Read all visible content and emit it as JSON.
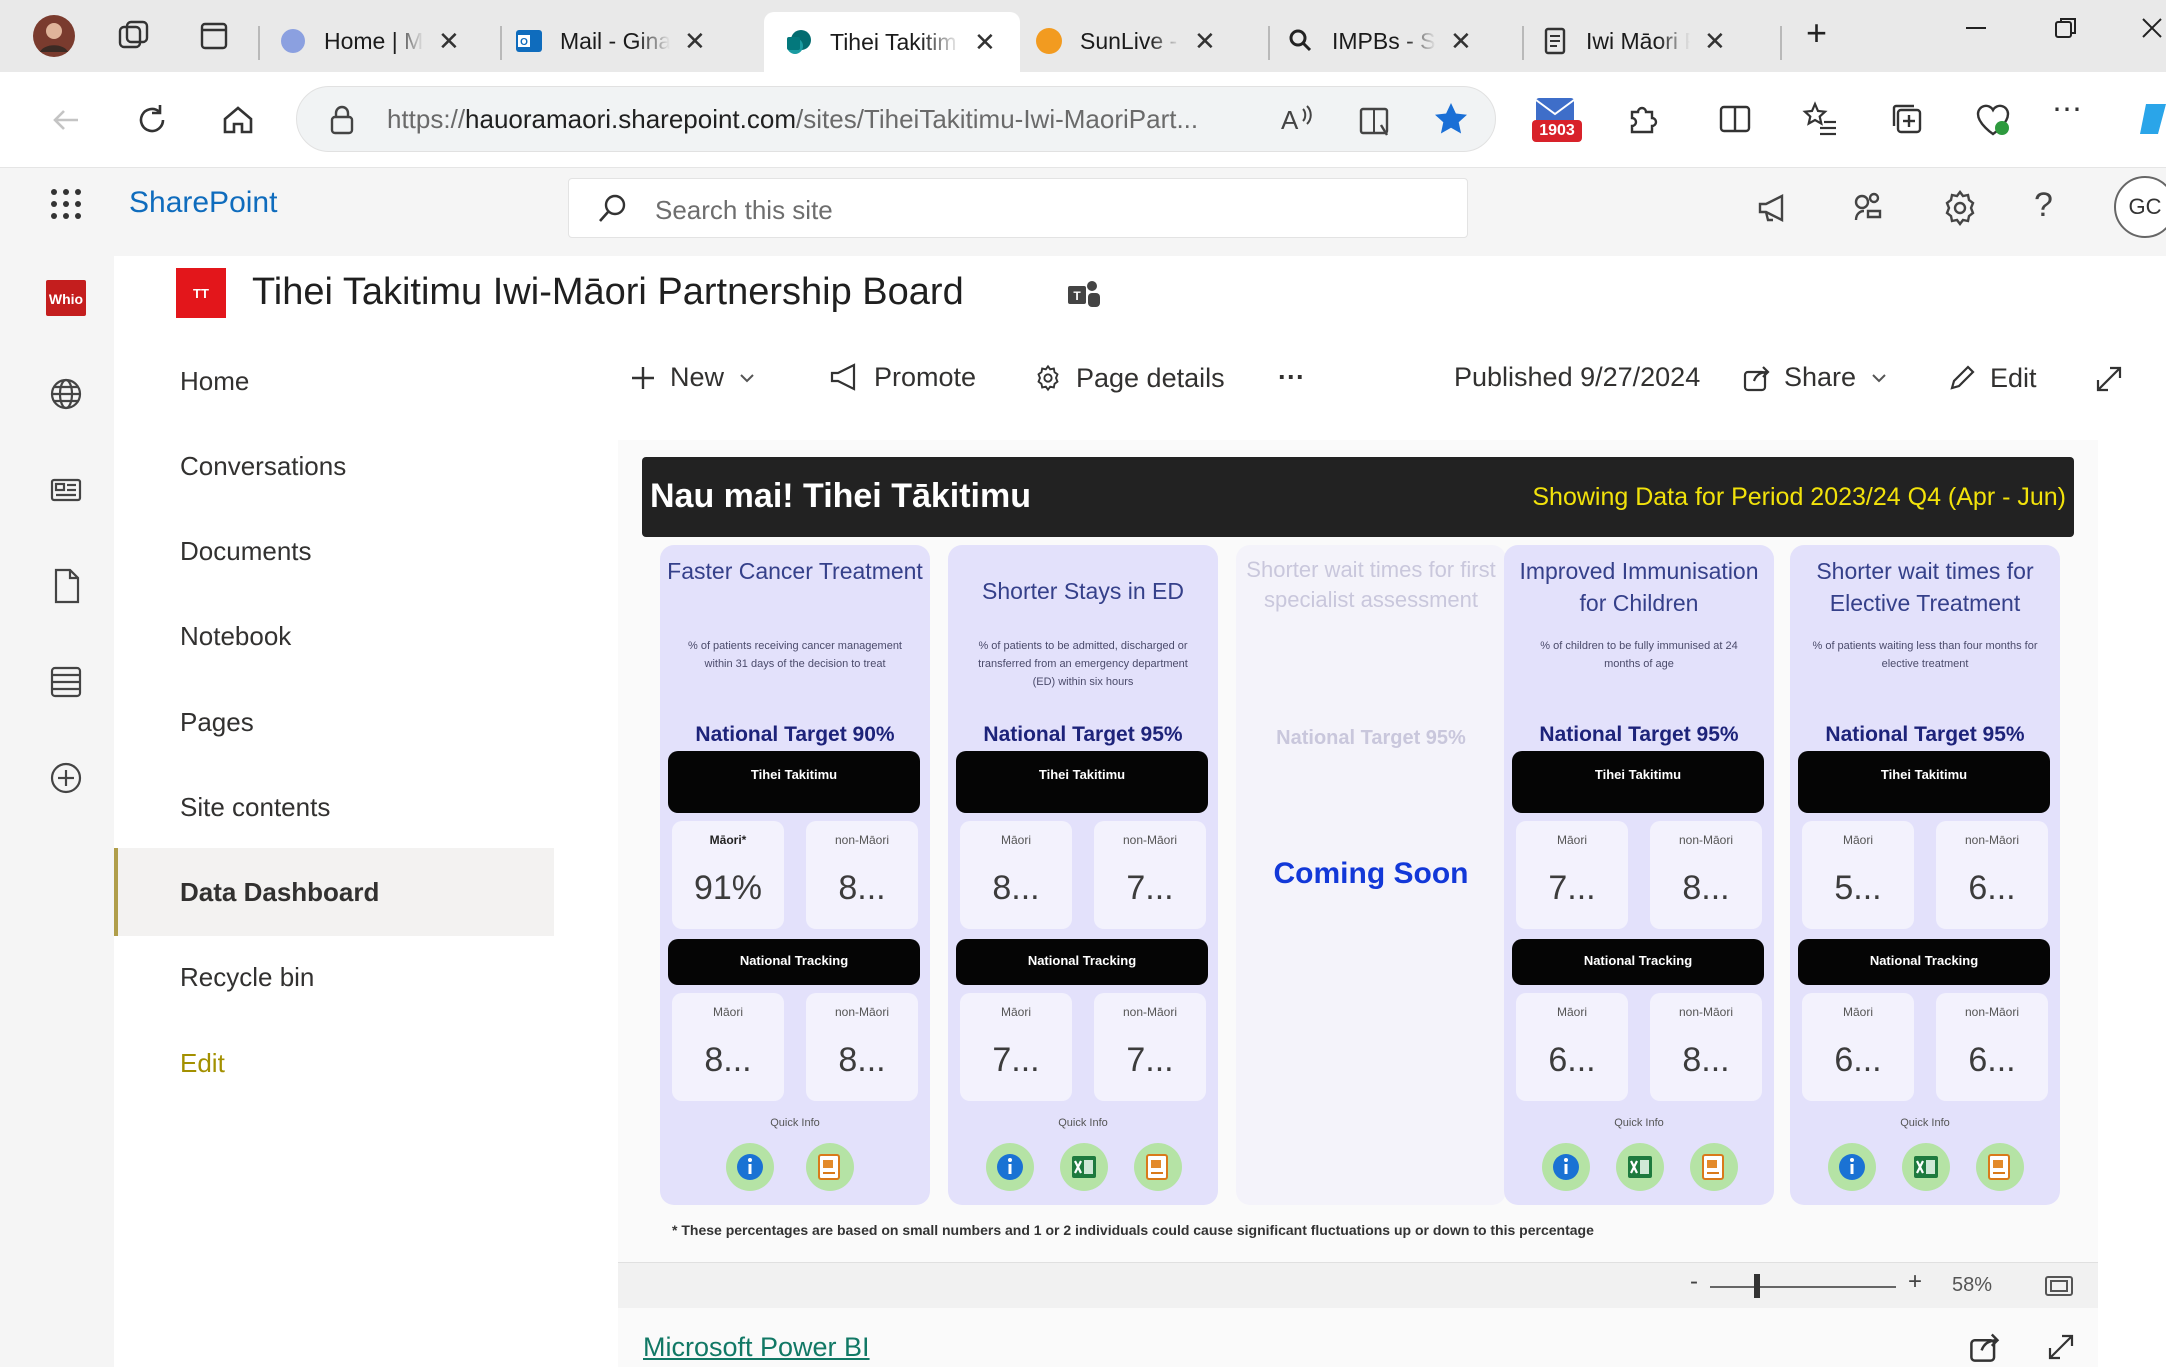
{
  "browser": {
    "tabs": [
      {
        "label": "Home | Micr",
        "active": false
      },
      {
        "label": "Mail - Gina C",
        "active": false
      },
      {
        "label": "Tihei Takitim",
        "active": true
      },
      {
        "label": "SunLive - Ma",
        "active": false
      },
      {
        "label": "IMPBs - Sear",
        "active": false
      },
      {
        "label": "Iwi Māori Pa",
        "active": false
      }
    ],
    "close_glyph": "✕",
    "new_tab_glyph": "+",
    "url_prefix": "https://",
    "url_domain": "hauoramaori.sharepoint.com",
    "url_path": "/sites/TiheiTakitimu-Iwi-MaoriPart...",
    "badge_count": "1903"
  },
  "suite": {
    "brand": "SharePoint",
    "search_placeholder": "Search this site",
    "avatar_initials": "GC"
  },
  "site": {
    "logo_text": "TT",
    "title": "Tihei Takitimu Iwi-Māori Partnership Board"
  },
  "nav": {
    "items": [
      {
        "label": "Home"
      },
      {
        "label": "Conversations"
      },
      {
        "label": "Documents"
      },
      {
        "label": "Notebook"
      },
      {
        "label": "Pages"
      },
      {
        "label": "Site contents"
      },
      {
        "label": "Data Dashboard"
      },
      {
        "label": "Recycle bin"
      },
      {
        "label": "Edit"
      }
    ],
    "selected": "Data Dashboard"
  },
  "commandbar": {
    "new": "New",
    "promote": "Promote",
    "page_details": "Page details",
    "more": "···",
    "published": "Published 9/27/2024",
    "share": "Share",
    "edit": "Edit"
  },
  "dashboard": {
    "title": "Nau mai! Tihei Tākitimu",
    "period": "Showing Data for Period 2023/24 Q4 (Apr - Jun)",
    "bar_local": "Tihei Takitimu",
    "bar_national": "National Tracking",
    "quick_info": "Quick Info",
    "coming_soon": "Coming Soon",
    "footnote": "* These percentages are based on small numbers and 1 or 2 individuals could cause significant fluctuations up or down to this percentage",
    "cards": [
      {
        "title": "Faster Cancer Treatment",
        "desc": "% of patients receiving cancer management within 31 days of the decision to treat",
        "target": "National Target 90%",
        "local_maori_label": "Māori*",
        "local_maori": "91%",
        "local_non_label": "non-Māori",
        "local_non": "8...",
        "nat_maori_label": "Māori",
        "nat_maori": "8...",
        "nat_non_label": "non-Māori",
        "nat_non": "8..."
      },
      {
        "title": "Shorter Stays in ED",
        "desc": "% of patients to be admitted, discharged or transferred from an emergency department (ED) within six hours",
        "target": "National Target 95%",
        "local_maori_label": "Māori",
        "local_maori": "8...",
        "local_non_label": "non-Māori",
        "local_non": "7...",
        "nat_maori_label": "Māori",
        "nat_maori": "7...",
        "nat_non_label": "non-Māori",
        "nat_non": "7..."
      },
      {
        "title": "Shorter wait times for first specialist assessment",
        "target": "National Target 95%",
        "coming_soon": true
      },
      {
        "title": "Improved Immunisation for Children",
        "desc": "% of children to be fully immunised at 24 months of age",
        "target": "National Target 95%",
        "local_maori_label": "Māori",
        "local_maori": "7...",
        "local_non_label": "non-Māori",
        "local_non": "8...",
        "nat_maori_label": "Māori",
        "nat_maori": "6...",
        "nat_non_label": "non-Māori",
        "nat_non": "8..."
      },
      {
        "title": "Shorter wait times for Elective Treatment",
        "desc": "% of patients waiting less than four months for elective treatment",
        "target": "National Target 95%",
        "local_maori_label": "Māori",
        "local_maori": "5...",
        "local_non_label": "non-Māori",
        "local_non": "6...",
        "nat_maori_label": "Māori",
        "nat_maori": "6...",
        "nat_non_label": "non-Māori",
        "nat_non": "6..."
      }
    ],
    "zoom": {
      "minus": "-",
      "plus": "+",
      "value": "58%"
    },
    "powerbi_link": "Microsoft Power BI"
  }
}
